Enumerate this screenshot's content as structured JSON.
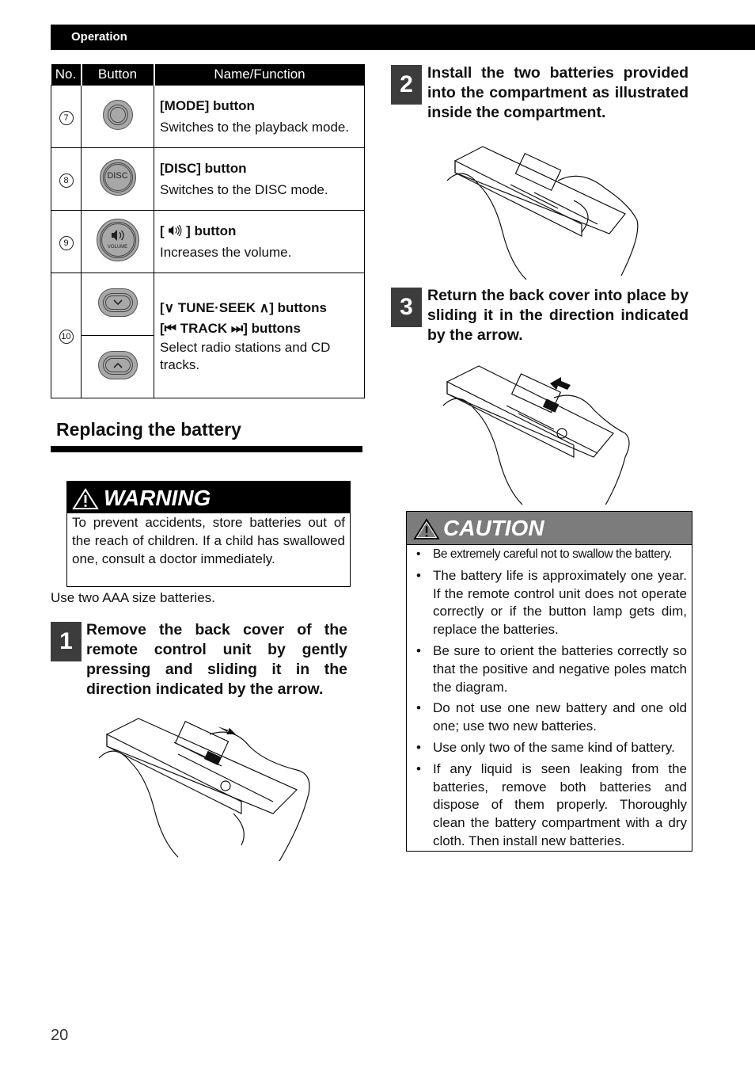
{
  "header": {
    "section": "Operation"
  },
  "table": {
    "columns": [
      "No.",
      "Button",
      "Name/Function"
    ],
    "rows": [
      {
        "no": "7",
        "icon": "mode-button-icon",
        "icon_label": "",
        "name": "[MODE] button",
        "function": "Switches to the playback mode."
      },
      {
        "no": "8",
        "icon": "disc-button-icon",
        "icon_label": "DISC",
        "name": "[DISC] button",
        "function": "Switches to the DISC mode."
      },
      {
        "no": "9",
        "icon": "volume-button-icon",
        "icon_label": "VOLUME",
        "name_prefix": "[",
        "name_symbol": "🔊",
        "name_suffix": "] button",
        "function": "Increases the volume."
      },
      {
        "no": "10",
        "icons": [
          "tune-seek-down-button-icon",
          "tune-seek-up-button-icon"
        ],
        "name_line1": "[∨  TUNE·SEEK  ∧] buttons",
        "name_line2": "[⏮  TRACK  ⏭] buttons",
        "function": "Select radio stations and CD tracks."
      }
    ]
  },
  "section": {
    "title": "Replacing the battery"
  },
  "warning": {
    "title": "WARNING",
    "text": "To prevent accidents, store batteries out of the reach of children. If a child has swallowed one, consult a doctor immediately."
  },
  "battery_note": "Use two AAA size batteries.",
  "steps": [
    {
      "number": "1",
      "text": "Remove the back cover of the remote control unit by gently pressing and sliding it in the direction indicated by the arrow."
    },
    {
      "number": "2",
      "text": "Install the two batteries provided into the compartment as illustrated inside the compartment."
    },
    {
      "number": "3",
      "text": "Return the back cover into place by sliding it in the direction indicated by the arrow."
    }
  ],
  "caution": {
    "title": "CAUTION",
    "items": [
      "Be extremely careful not to swallow the battery.",
      "The battery life is approximately one year. If the remote control unit does not operate correctly or if the button lamp gets dim, replace the batteries.",
      "Be sure to orient the batteries correctly so that the positive and negative poles match the diagram.",
      "Do not use one new battery and one old one; use two new batteries.",
      "Use only two of the same kind of battery.",
      "If any liquid is seen leaking from the batteries, remove both batteries and dispose of them properly. Thoroughly clean the battery compartment with a dry cloth. Then install new batteries."
    ]
  },
  "footer": {
    "page_number": "20"
  }
}
